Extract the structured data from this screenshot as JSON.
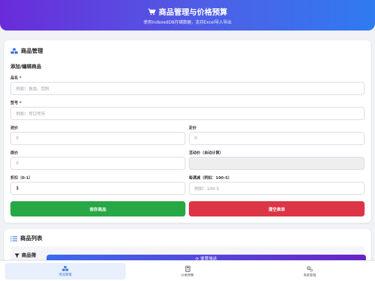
{
  "header": {
    "title": "商品管理与价格预算",
    "subtitle": "使用IndexedDB存储数据，支持Excel导入导出",
    "icon": "cart-icon"
  },
  "product_card": {
    "title": "商品管理",
    "icon": "boxes-icon",
    "form_title": "添加/编辑商品",
    "fields": {
      "name": {
        "label": "品名 *",
        "placeholder": "例如：食品、饮料"
      },
      "model": {
        "label": "型号 *",
        "placeholder": "例如：可口可乐"
      },
      "cost": {
        "label": "进价",
        "placeholder": "0"
      },
      "list_price": {
        "label": "定价",
        "placeholder": "0"
      },
      "original": {
        "label": "原价",
        "placeholder": "0"
      },
      "promo": {
        "label": "活动价（自动计算）",
        "value": ""
      },
      "discount": {
        "label": "折扣（0-1）",
        "value": "1"
      },
      "full_reduction": {
        "label": "每满减（例如：100-5）",
        "placeholder": "例如：100-5"
      }
    },
    "save_label": "保存商品",
    "clear_label": "清空表单",
    "colors": {
      "save": "#28a745",
      "clear": "#dc3545"
    }
  },
  "list_card": {
    "title": "商品列表",
    "icon": "list-icon",
    "filter_title": "商品筛",
    "filter_icon": "filter-icon",
    "reset_label": "⟳ 重置筛选"
  },
  "bottom_nav": {
    "items": [
      {
        "label": "商品管理",
        "icon": "boxes-icon",
        "active": true
      },
      {
        "label": "价格预算",
        "icon": "calculator-icon",
        "active": false
      },
      {
        "label": "系统管理",
        "icon": "gears-icon",
        "active": false
      }
    ],
    "accent": "#3a70d8"
  }
}
